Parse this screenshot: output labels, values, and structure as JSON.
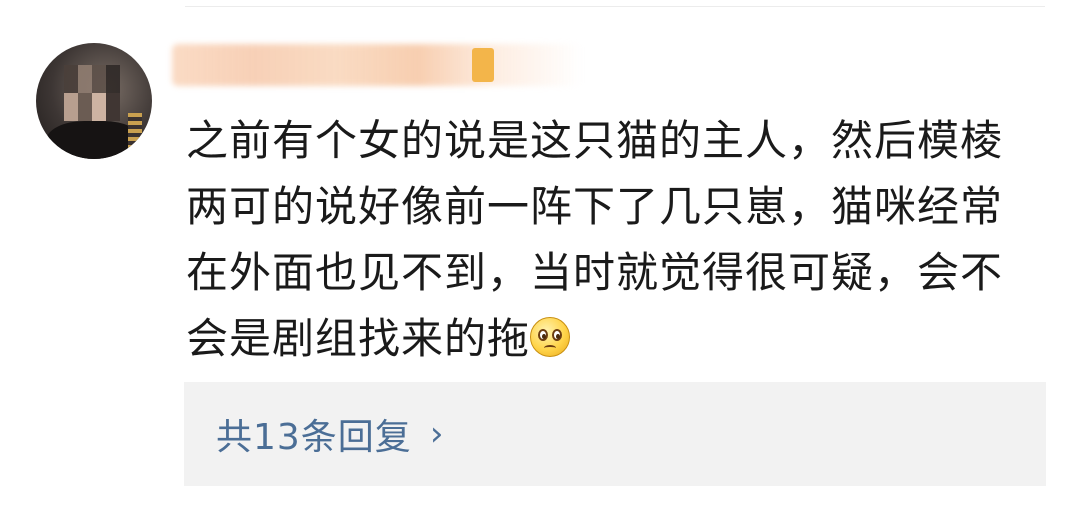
{
  "comment": {
    "line1": "之前有个女的说是这只猫的主人，然后模棱",
    "line2": "两可的说好像前一阵下了几只崽，猫咪经常",
    "line3": "在外面也见不到，当时就觉得很可疑，会不",
    "line4": "会是剧组找来的拖",
    "emoji": "pleading-face-emoji"
  },
  "replies": {
    "label": "共13条回复",
    "chevron": "›"
  },
  "colors": {
    "link": "#4b6e96",
    "reply_bg": "#f2f2f2",
    "text": "#1a1a1a"
  }
}
